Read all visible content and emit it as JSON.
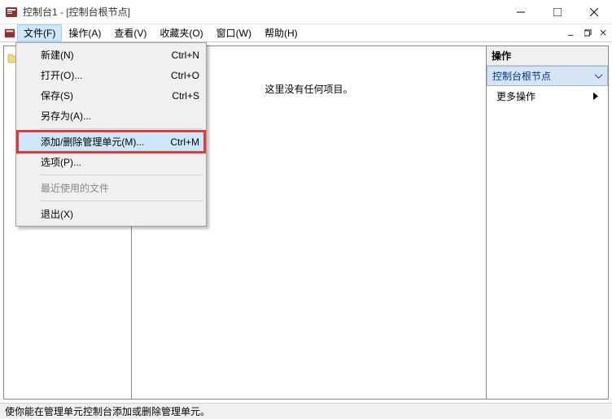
{
  "title": "控制台1 - [控制台根节点]",
  "menus": {
    "file": "文件(F)",
    "action": "操作(A)",
    "view": "查看(V)",
    "favorites": "收藏夹(O)",
    "window": "窗口(W)",
    "help": "帮助(H)"
  },
  "dropdown": {
    "new": {
      "label": "新建(N)",
      "shortcut": "Ctrl+N"
    },
    "open": {
      "label": "打开(O)...",
      "shortcut": "Ctrl+O"
    },
    "save": {
      "label": "保存(S)",
      "shortcut": "Ctrl+S"
    },
    "saveas": {
      "label": "另存为(A)..."
    },
    "addremove": {
      "label": "添加/删除管理单元(M)...",
      "shortcut": "Ctrl+M"
    },
    "options": {
      "label": "选项(P)..."
    },
    "recent": {
      "label": "最近使用的文件"
    },
    "exit": {
      "label": "退出(X)"
    }
  },
  "tree": {
    "root": "控制台根节点"
  },
  "mid": {
    "empty": "这里没有任何项目。"
  },
  "actions": {
    "header": "操作",
    "band": "控制台根节点",
    "more": "更多操作"
  },
  "status": "使你能在管理单元控制台添加或删除管理单元。"
}
